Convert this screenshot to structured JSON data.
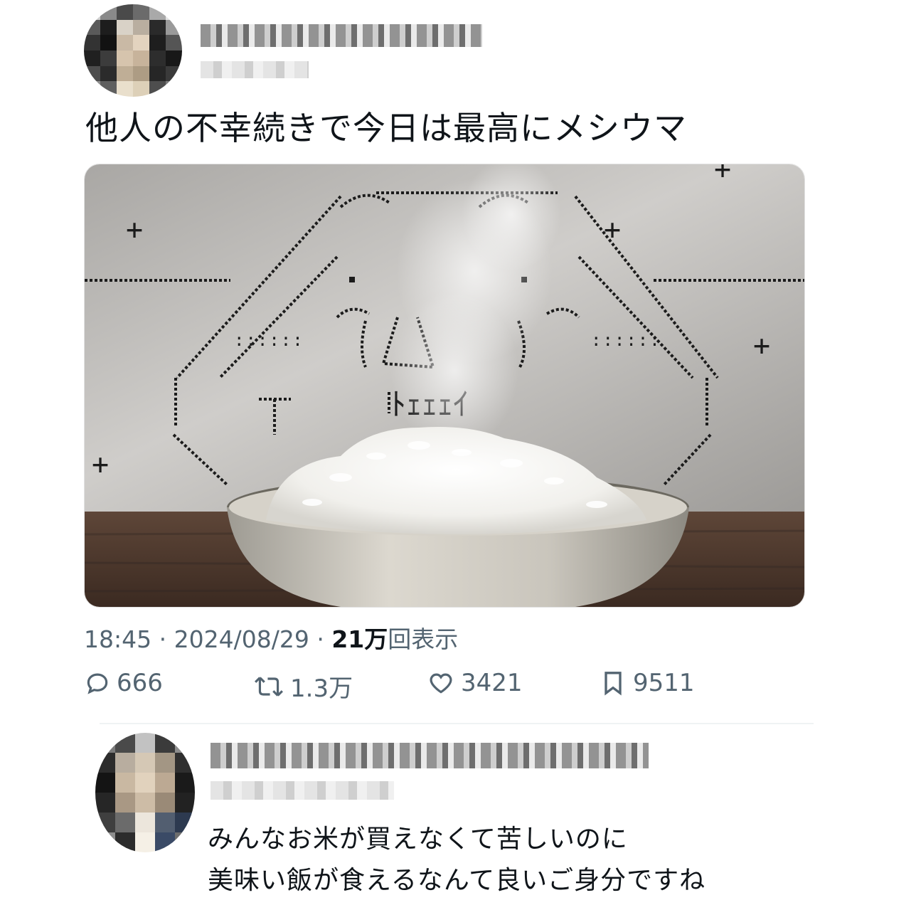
{
  "tweet": {
    "text": "他人の不幸続きで今日は最高にメシウマ",
    "time": "18:45",
    "date": "2024/08/29",
    "views_count": "21万",
    "views_label": "回表示",
    "separator": "·",
    "media": {
      "ascii_art_caption": "ﾄｪｪｪｲ"
    }
  },
  "actions": {
    "reply_count": "666",
    "retweet_count": "1.3万",
    "like_count": "3421",
    "bookmark_count": "9511"
  },
  "reply": {
    "line1": "みんなお米が買えなくて苦しいのに",
    "line2": "美味い飯が食えるなんて良いご身分ですね"
  },
  "icons": [
    "reply-icon",
    "retweet-icon",
    "like-icon",
    "bookmark-icon"
  ]
}
